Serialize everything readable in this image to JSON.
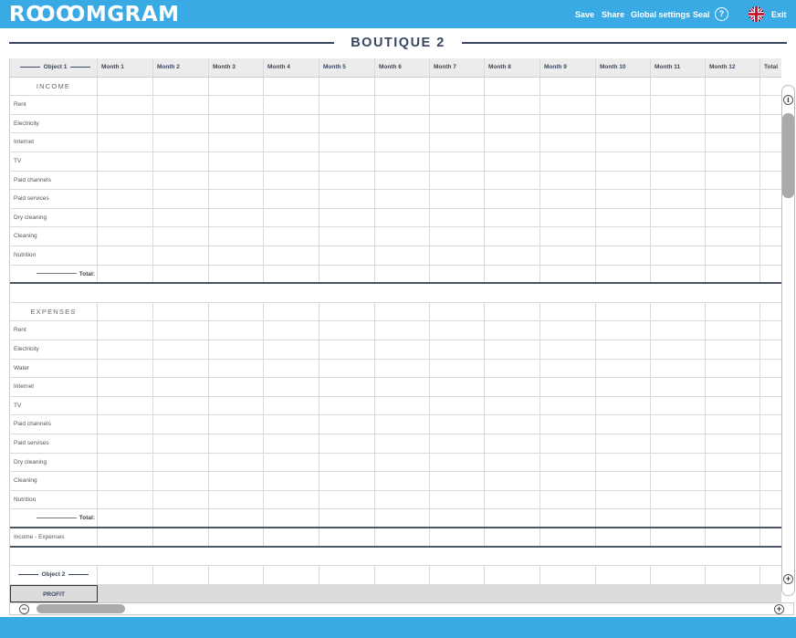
{
  "app": {
    "logo_text": "RꝎꝎMGRAM"
  },
  "nav": {
    "save": "Save",
    "share": "Share",
    "global_settings": "Global settings",
    "seal": "Seal",
    "help_icon": "?",
    "language_icon": "uk-flag-icon",
    "exit": "Exit"
  },
  "colors": {
    "brand": "#3aaae5",
    "title": "#38475f",
    "profit_bg": "#dcdcdc",
    "header_bg": "#ececec"
  },
  "page": {
    "title": "BOUTIQUE 2"
  },
  "table": {
    "object_label": "Object 1",
    "months": [
      "Month 1",
      "Month 2",
      "Month 3",
      "Month 4",
      "Month 5",
      "Month 6",
      "Month 7",
      "Month 8",
      "Month 9",
      "Month 10",
      "Month 11",
      "Month 12"
    ],
    "total_header": "Total",
    "income_section": "INCOME",
    "income_rows": [
      "Rent",
      "Electricity",
      "Internet",
      "TV",
      "Paid channels",
      "Paid services",
      "Dry cleaning",
      "Cleaning",
      "Nutrition"
    ],
    "income_total": "Total:",
    "expenses_section": "EXPENSES",
    "expense_rows": [
      "Rent",
      "Electricity",
      "Water",
      "Internet",
      "TV",
      "Paid channels",
      "Paid servises",
      "Dry cleaning",
      "Cleaning",
      "Nutrition"
    ],
    "expenses_total": "Total:",
    "difference_label": "Income - Expenses",
    "object2_label": "Object 2",
    "profit_label": "PROFIT"
  },
  "scroll": {
    "info_icon": "i",
    "expand_icon": "+",
    "collapse_icon": "−"
  }
}
